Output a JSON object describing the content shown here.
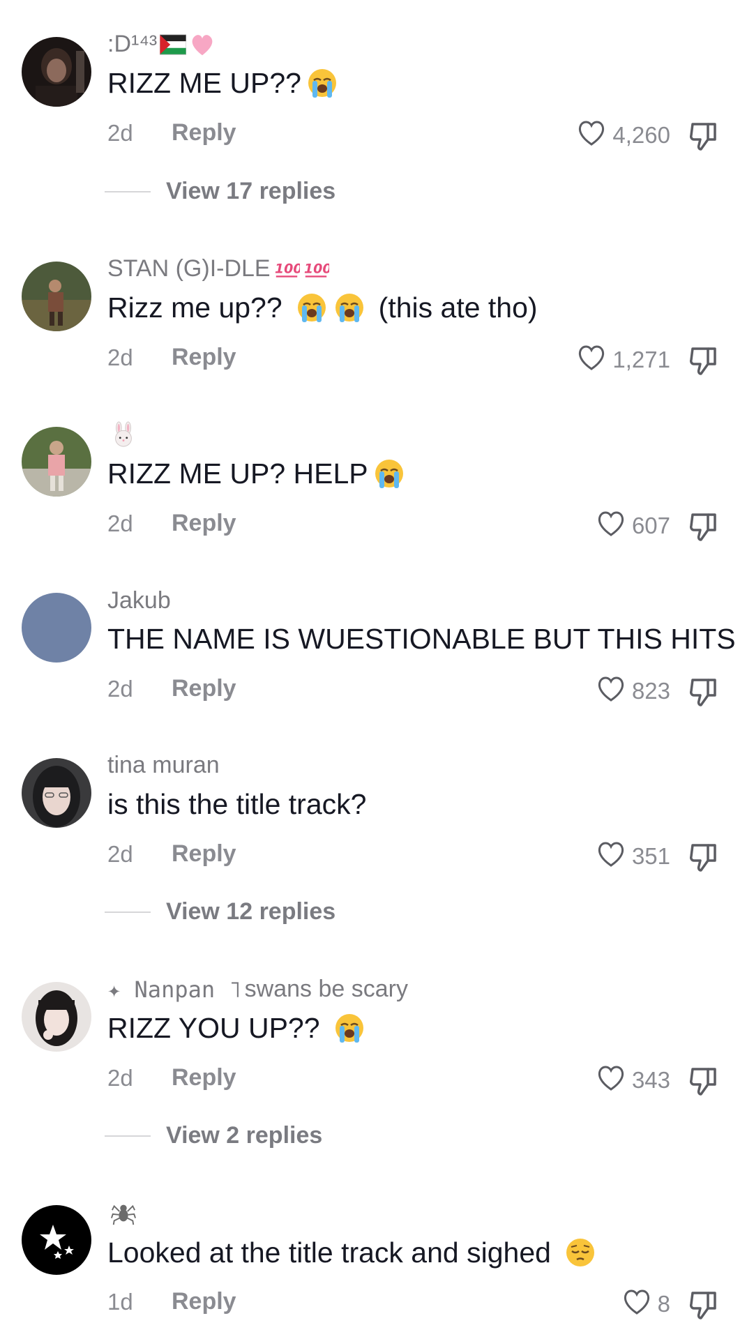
{
  "comments": [
    {
      "username": ":D¹⁴³",
      "username_icons": [
        "palestine-flag-icon",
        "pink-heart-icon"
      ],
      "text": "RIZZ ME UP??",
      "text_emoji": [
        "loudly-crying-face-icon"
      ],
      "time": "2d",
      "reply_label": "Reply",
      "likes": "4,260",
      "view_replies": "View 17 replies"
    },
    {
      "username": "STAN (G)I-DLE",
      "username_icons": [
        "hundred-points-icon",
        "hundred-points-icon"
      ],
      "text": "Rizz me up??",
      "text_emoji": [
        "loudly-crying-face-icon",
        "loudly-crying-face-icon"
      ],
      "text_suffix": "(this ate tho)",
      "time": "2d",
      "reply_label": "Reply",
      "likes": "1,271"
    },
    {
      "username": "",
      "username_icons": [
        "rabbit-face-icon"
      ],
      "text": "RIZZ ME UP? HELP",
      "text_emoji": [
        "loudly-crying-face-icon"
      ],
      "time": "2d",
      "reply_label": "Reply",
      "likes": "607"
    },
    {
      "username": "Jakub",
      "text": "THE NAME IS WUESTIONABLE BUT THIS HITS",
      "time": "2d",
      "reply_label": "Reply",
      "likes": "823"
    },
    {
      "username": "tina muran",
      "text": "is this the title track?",
      "time": "2d",
      "reply_label": "Reply",
      "likes": "351",
      "view_replies": "View 12 replies"
    },
    {
      "username_prefix": "✦ Nanpan ˥",
      "username": "swans be scary",
      "text": "RIZZ YOU UP??",
      "text_emoji": [
        "loudly-crying-face-icon"
      ],
      "time": "2d",
      "reply_label": "Reply",
      "likes": "343",
      "view_replies": "View 2 replies"
    },
    {
      "username": "",
      "username_icons": [
        "spider-icon"
      ],
      "text": "Looked at the title track and sighed",
      "text_emoji": [
        "pensive-face-icon"
      ],
      "time": "1d",
      "reply_label": "Reply",
      "likes": "8"
    }
  ],
  "colors": {
    "text_primary": "#161823",
    "text_secondary": "#8a8b91",
    "avatar_jakub": "#6f82a6"
  }
}
